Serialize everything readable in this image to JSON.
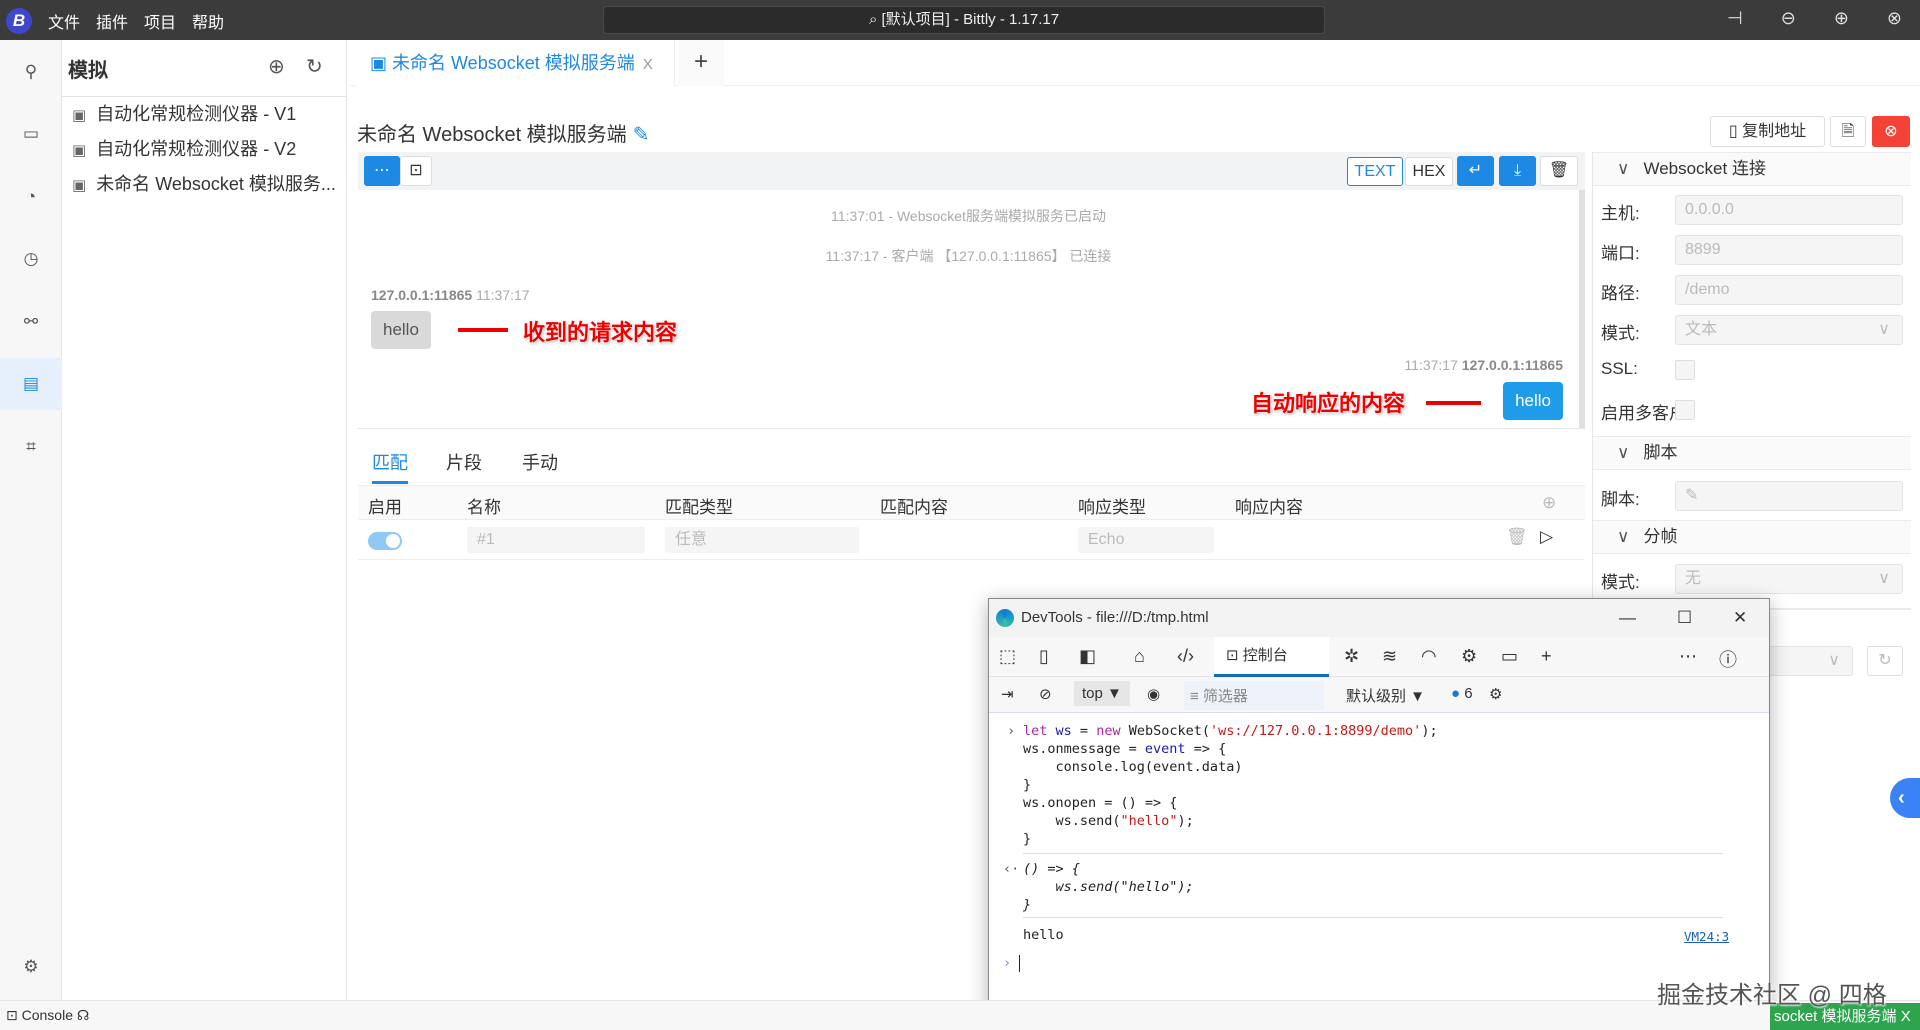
{
  "titlebar": {
    "logo": "B",
    "menu": [
      "文件",
      "插件",
      "项目",
      "帮助"
    ],
    "search": "[默认项目] - Bittly - 1.17.17",
    "buttons": [
      "pin-icon",
      "minimize-icon",
      "maximize-icon",
      "close-icon"
    ]
  },
  "sidebar": {
    "title": "模拟",
    "items": [
      {
        "label": "自动化常规检测仪器 - V1"
      },
      {
        "label": "自动化常规检测仪器 - V2"
      },
      {
        "label": "未命名 Websocket 模拟服务..."
      }
    ]
  },
  "tabs": [
    {
      "label": "未命名 Websocket 模拟服务端",
      "active": true
    }
  ],
  "page": {
    "title": "未命名 Websocket 模拟服务端",
    "copy_address": "复制地址"
  },
  "toolbar": {
    "text": "TEXT",
    "hex": "HEX"
  },
  "chat": {
    "system": [
      "11:37:01 - Websocket服务端模拟服务已启动",
      "11:37:17 - 客户端 【127.0.0.1:11865】 已连接"
    ],
    "received": {
      "host": "127.0.0.1:11865",
      "time": "11:37:17",
      "content": "hello"
    },
    "sent": {
      "host": "127.0.0.1:11865",
      "time": "11:37:17",
      "content": "hello"
    },
    "annotation_received": "收到的请求内容",
    "annotation_sent": "自动响应的内容"
  },
  "bottom_tabs": [
    "匹配",
    "片段",
    "手动"
  ],
  "table": {
    "headers": [
      "启用",
      "名称",
      "匹配类型",
      "匹配内容",
      "响应类型",
      "响应内容"
    ],
    "rows": [
      {
        "enabled": true,
        "name": "#1",
        "match_type": "任意",
        "match_content": "",
        "response_type": "Echo",
        "response_content": ""
      }
    ]
  },
  "right_panel": {
    "ws_section": "Websocket 连接",
    "host_label": "主机:",
    "host": "0.0.0.0",
    "port_label": "端口:",
    "port": "8899",
    "path_label": "路径:",
    "path": "/demo",
    "mode_label": "模式:",
    "mode": "文本",
    "ssl_label": "SSL:",
    "ssl": false,
    "multi_label": "启用多客户",
    "multi": false,
    "script_section": "脚本",
    "script_label": "脚本:",
    "frame_section": "分帧",
    "frame_mode_label": "模式:",
    "frame_mode": "无"
  },
  "devtools": {
    "title": "DevTools - file:///D:/tmp.html",
    "console_tab": "控制台",
    "context": "top",
    "filter_placeholder": "筛选器",
    "level": "默认级别",
    "message_count": "6",
    "input_lines": [
      "let ws = new WebSocket('ws://127.0.0.1:8899/demo');",
      "ws.onmessage = event => {",
      "    console.log(event.data)",
      "}",
      "ws.onopen = () => {",
      "    ws.send(\"hello\");",
      "}"
    ],
    "result_lines": [
      "() => {",
      "    ws.send(\"hello\");",
      "}"
    ],
    "log": "hello",
    "log_source": "VM24:3"
  },
  "status": {
    "console": "Console",
    "bottom_tab": "socket 模拟服务端 X"
  },
  "watermark": "掘金技术社区 @ 四格",
  "colors": {
    "accent": "#1e88e5",
    "danger": "#f44336",
    "bubble_sent": "#1e9be9",
    "bubble_received": "#d9d9d9",
    "bottom_tab": "#2ea44f"
  }
}
